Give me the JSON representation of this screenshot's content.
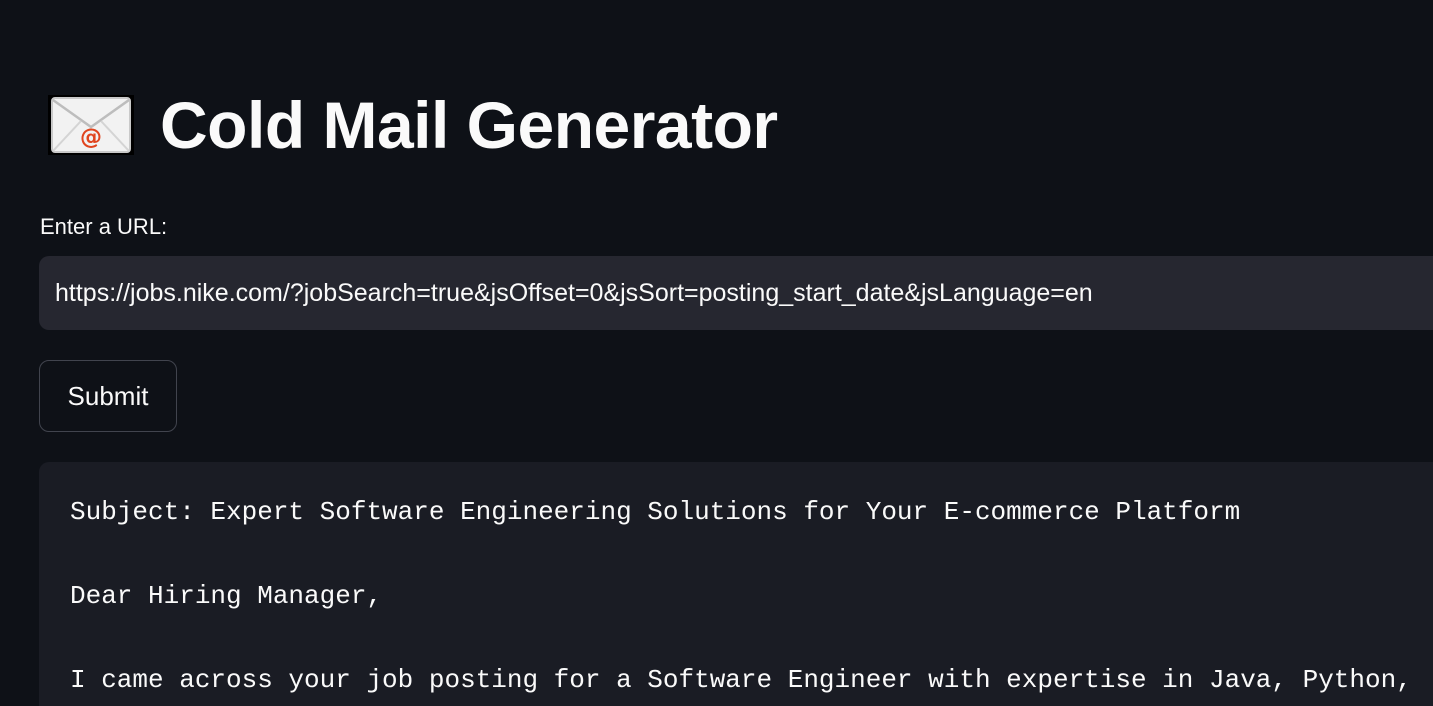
{
  "header": {
    "icon": "envelope-with-at-icon",
    "title": "Cold Mail Generator"
  },
  "form": {
    "url_label": "Enter a URL:",
    "url_value": "https://jobs.nike.com/?jobSearch=true&jsOffset=0&jsSort=posting_start_date&jsLanguage=en",
    "submit_label": "Submit"
  },
  "output": {
    "lines": [
      "Subject: Expert Software Engineering Solutions for Your E-commerce Platform",
      "Dear Hiring Manager,",
      "I came across your job posting for a Software Engineer with expertise in Java, Python,"
    ]
  },
  "colors": {
    "background": "#0e1117",
    "input_bg": "#262730",
    "code_bg": "#1a1c24",
    "text": "#fafafa",
    "envelope_accent": "#e0451f"
  }
}
